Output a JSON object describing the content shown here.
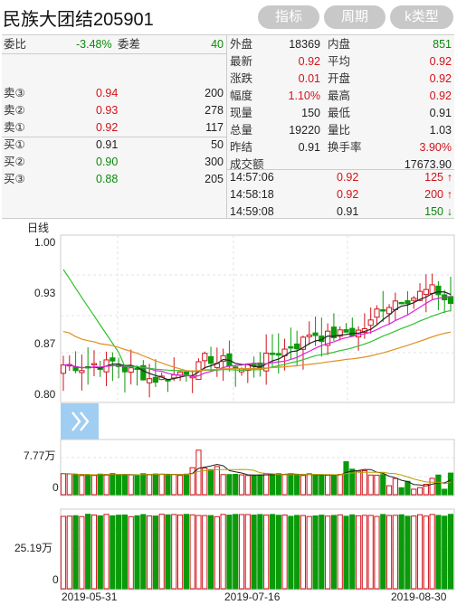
{
  "header": {
    "title": "民族大团结205901",
    "buttons": [
      "指标",
      "周期",
      "k类型"
    ]
  },
  "quote": {
    "weibi_label": "委比",
    "weibi_value": "-3.48%",
    "weicha_label": "委差",
    "weicha_value": "40",
    "asks": [
      {
        "label": "卖③",
        "price": "0.94",
        "vol": "200"
      },
      {
        "label": "卖②",
        "price": "0.93",
        "vol": "278"
      },
      {
        "label": "卖①",
        "price": "0.92",
        "vol": "117"
      }
    ],
    "bids": [
      {
        "label": "买①",
        "price": "0.91",
        "vol": "50"
      },
      {
        "label": "买②",
        "price": "0.90",
        "vol": "300"
      },
      {
        "label": "买③",
        "price": "0.88",
        "vol": "205"
      }
    ],
    "stats": [
      {
        "l1": "外盘",
        "v1": "18369",
        "l2": "内盘",
        "v2": "851"
      },
      {
        "l1": "最新",
        "v1": "0.92",
        "l2": "平均",
        "v2": "0.92"
      },
      {
        "l1": "涨跌",
        "v1": "0.01",
        "l2": "开盘",
        "v2": "0.92"
      },
      {
        "l1": "幅度",
        "v1": "1.10%",
        "l2": "最高",
        "v2": "0.92"
      },
      {
        "l1": "现量",
        "v1": "150",
        "l2": "最低",
        "v2": "0.91"
      },
      {
        "l1": "总量",
        "v1": "19220",
        "l2": "量比",
        "v2": "1.03"
      },
      {
        "l1": "昨结",
        "v1": "0.91",
        "l2": "换手率",
        "v2": "3.90%"
      }
    ],
    "turnover_label": "成交额",
    "turnover_value": "17673.90",
    "ticks": [
      {
        "time": "14:57:06",
        "price": "0.92",
        "vol": "125",
        "dir": "↑"
      },
      {
        "time": "14:58:18",
        "price": "0.92",
        "vol": "200",
        "dir": "↑"
      },
      {
        "time": "14:59:08",
        "price": "0.91",
        "vol": "150",
        "dir": "↓"
      }
    ]
  },
  "chart_data": [
    {
      "type": "candlestick",
      "period_label": "日线",
      "y_ticks": [
        "1.00",
        "0.93",
        "0.87",
        "0.80"
      ],
      "ylim": [
        0.8,
        1.0
      ],
      "x_ticks": [
        "2019-05-31",
        "2019-07-16",
        "2019-08-30"
      ],
      "colors": {
        "up": "#d0131b",
        "down": "#0a9a0a",
        "ma1": "#222222",
        "ma2": "#e020e0",
        "ma3": "#30c030",
        "ma4": "#e09020"
      }
    },
    {
      "type": "bar",
      "name": "volume",
      "y_ticks": [
        "7.77万",
        "0"
      ],
      "ylim": [
        0,
        10
      ]
    },
    {
      "type": "bar",
      "name": "open_interest",
      "y_ticks": [
        "25.19万",
        "0"
      ],
      "ylim": [
        0,
        36
      ]
    }
  ]
}
